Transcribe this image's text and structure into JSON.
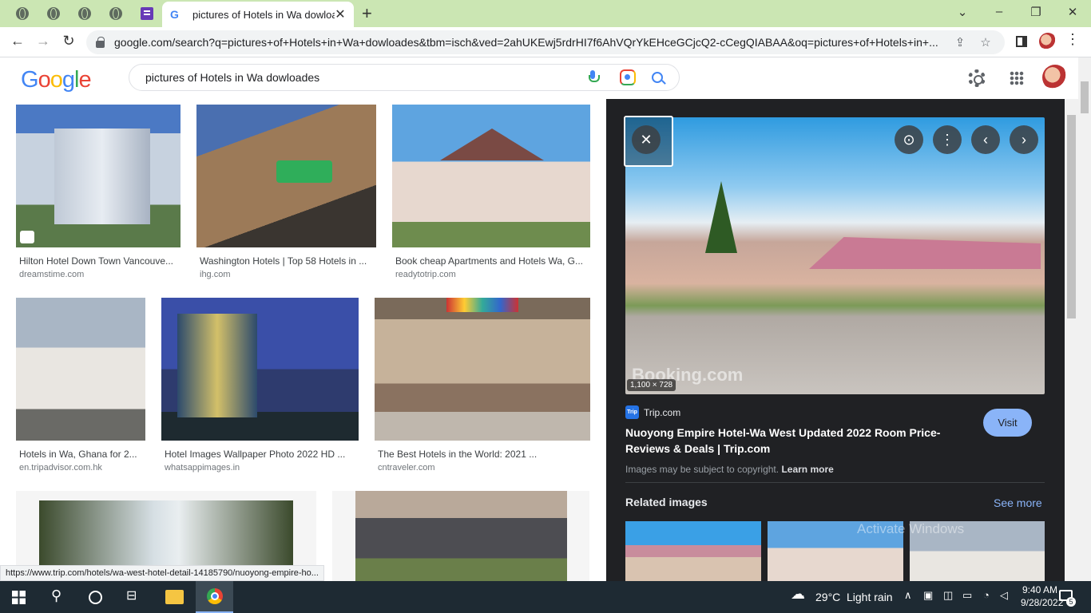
{
  "browser": {
    "active_tab_title": "pictures of Hotels in Wa dowloac",
    "url": "google.com/search?q=pictures+of+Hotels+in+Wa+dowloades&tbm=isch&ved=2ahUKEwj5rdrHI7f6AhVQrYkEHceGCjcQ2-cCegQIABAA&oq=pictures+of+Hotels+in+..."
  },
  "google": {
    "logo": [
      "G",
      "o",
      "o",
      "g",
      "l",
      "e"
    ],
    "logo_colors": [
      "#4285f4",
      "#ea4335",
      "#fbbc05",
      "#4285f4",
      "#34a853",
      "#ea4335"
    ],
    "query": "pictures of Hotels in Wa dowloades"
  },
  "results": [
    {
      "title": "Hilton Hotel Down Town Vancouve...",
      "source": "dreamstime.com"
    },
    {
      "title": "Washington Hotels | Top 58 Hotels in ...",
      "source": "ihg.com"
    },
    {
      "title": "Book cheap Apartments and Hotels Wa, G...",
      "source": "readytotrip.com"
    },
    {
      "title": "Hotels in Wa, Ghana for 2...",
      "source": "en.tripadvisor.com.hk"
    },
    {
      "title": "Hotel Images Wallpaper Photo 2022 HD ...",
      "source": "whatsappimages.in"
    },
    {
      "title": "The Best Hotels in the World: 2021 ...",
      "source": "cntraveler.com"
    }
  ],
  "panel": {
    "image_size": "1,100 × 728",
    "watermark": "Booking.com",
    "source_badge": "Trip",
    "source": "Trip.com",
    "title": "Nuoyong Empire Hotel-Wa West Updated 2022 Room Price-Reviews & Deals | Trip.com",
    "visit_label": "Visit",
    "copyright_text": "Images may be subject to copyright.",
    "learn_more": "Learn more",
    "related_label": "Related images",
    "see_more": "See more"
  },
  "status_url": "https://www.trip.com/hotels/wa-west-hotel-detail-14185790/nuoyong-empire-ho...",
  "watermark_text": "Activate Windows",
  "taskbar": {
    "temperature": "29°C",
    "weather": "Light rain",
    "time": "9:40 AM",
    "date": "9/28/2022",
    "notifications": "5"
  }
}
